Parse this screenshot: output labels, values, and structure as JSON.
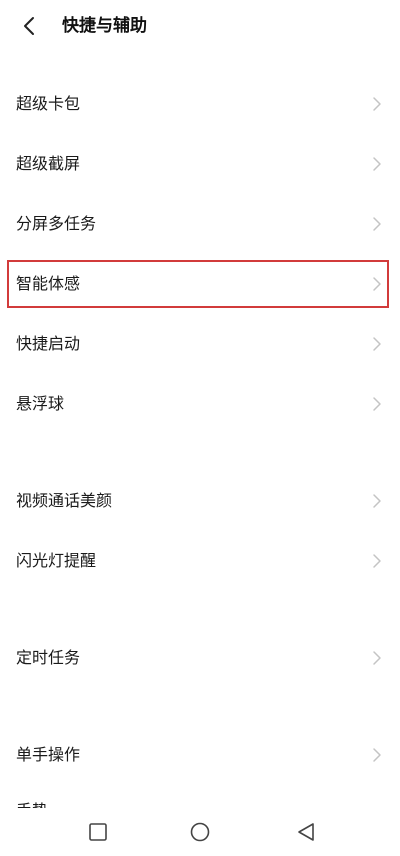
{
  "header": {
    "back_icon": "chevron-left-icon",
    "title": "快捷与辅助"
  },
  "items": [
    {
      "label": "超级卡包"
    },
    {
      "label": "超级截屏"
    },
    {
      "label": "分屏多任务"
    },
    {
      "label": "智能体感"
    },
    {
      "label": "快捷启动"
    },
    {
      "label": "悬浮球"
    },
    {
      "label": "视频通话美颜"
    },
    {
      "label": "闪光灯提醒"
    },
    {
      "label": "定时任务"
    },
    {
      "label": "单手操作"
    }
  ],
  "partial_item": {
    "label": "手势"
  },
  "colors": {
    "highlight": "#d23b3b",
    "chevron": "#c4c4c4"
  },
  "nav": {
    "recents_icon": "square-icon",
    "home_icon": "circle-icon",
    "back_icon": "triangle-back-icon"
  }
}
